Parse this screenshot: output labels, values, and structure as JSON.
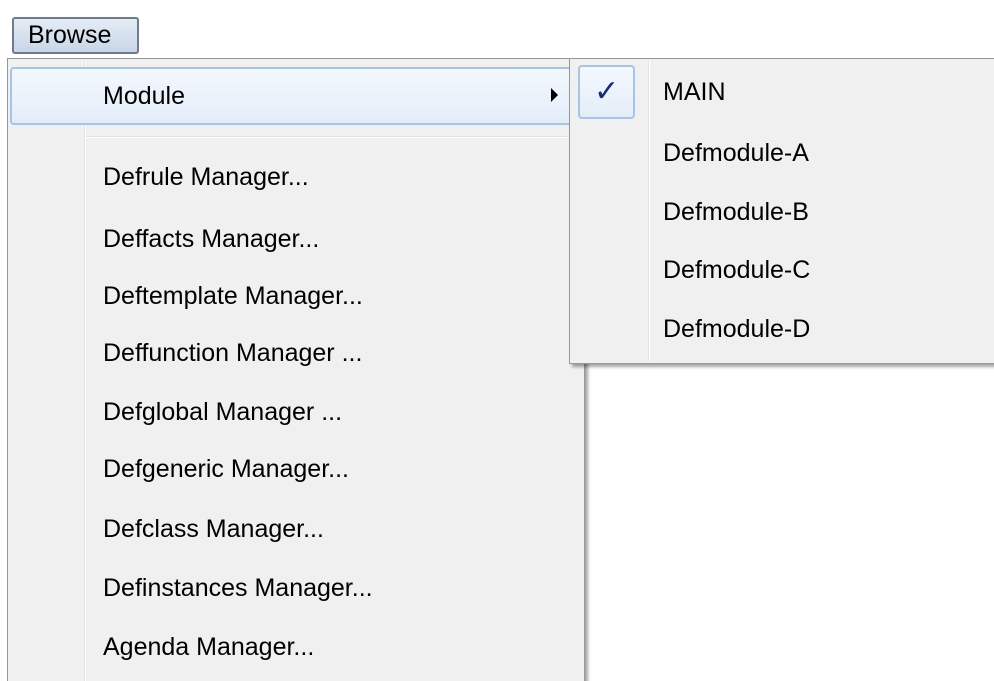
{
  "menubar": {
    "browse_label": "Browse"
  },
  "browse_menu": {
    "items": [
      {
        "label": "Module",
        "has_submenu": true,
        "highlighted": true
      },
      {
        "label": "Defrule Manager..."
      },
      {
        "label": "Deffacts Manager..."
      },
      {
        "label": "Deftemplate Manager..."
      },
      {
        "label": "Deffunction Manager ..."
      },
      {
        "label": "Defglobal Manager ..."
      },
      {
        "label": "Defgeneric Manager..."
      },
      {
        "label": "Defclass Manager..."
      },
      {
        "label": "Definstances Manager..."
      },
      {
        "label": "Agenda Manager..."
      }
    ]
  },
  "module_submenu": {
    "items": [
      {
        "label": "MAIN",
        "checked": true
      },
      {
        "label": "Defmodule-A",
        "checked": false
      },
      {
        "label": "Defmodule-B",
        "checked": false
      },
      {
        "label": "Defmodule-C",
        "checked": false
      },
      {
        "label": "Defmodule-D",
        "checked": false
      }
    ],
    "check_glyph": "✓"
  },
  "colors": {
    "menu_background": "#f0f0f0",
    "highlight_border": "#a7c4e6",
    "check_color": "#1b2a7a"
  },
  "icons": {
    "submenu_arrow": "chevron-right-icon",
    "check": "checkmark-icon"
  }
}
